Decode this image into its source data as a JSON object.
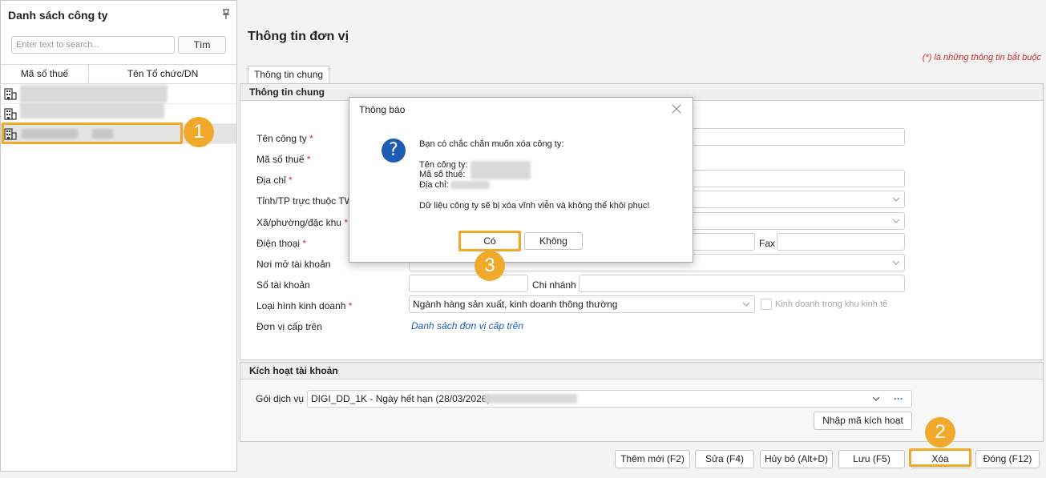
{
  "left_panel": {
    "title": "Danh sách công ty",
    "search_placeholder": "Enter text to search...",
    "search_button": "Tìm",
    "columns": [
      "Mã số thuế",
      "Tên Tổ chức/DN"
    ]
  },
  "form": {
    "title": "Thông tin đơn vị",
    "required_note": "(*) là những thông tin bắt buộc",
    "tab": "Thông tin chung",
    "section_general": "Thông tin chung",
    "fields": {
      "company_name": "Tên công ty",
      "tax_code": "Mã số thuế",
      "address": "Địa chỉ",
      "province": "Tỉnh/TP trực thuộc TW",
      "ward": "Xã/phường/đặc khu",
      "phone": "Điện thoại",
      "fax": "Fax",
      "bank": "Nơi mở tài khoản",
      "account_no": "Số tài khoản",
      "branch": "Chi nhánh",
      "business_type": "Loại hình kinh doanh",
      "parent_unit": "Đơn vị cấp trên"
    },
    "required_mark": "*",
    "business_type_value": "Ngành hàng sản xuất, kinh doanh thông thường",
    "industrial_zone_label": "Kinh doanh trong khu kinh tế",
    "parent_link": "Danh sách đơn vị cấp trên",
    "section_activation": "Kích hoạt tài khoản",
    "service_label": "Gói dịch vụ",
    "service_value": "DIGI_DD_1K - Ngày hết hạn (28/03/2026) -",
    "more_button": "···",
    "enter_code_button": "Nhập mã kích hoạt"
  },
  "toolbar": {
    "add": "Thêm mới (F2)",
    "edit": "Sửa (F4)",
    "cancel": "Hủy bỏ (Alt+D)",
    "save": "Lưu (F5)",
    "delete": "Xóa",
    "close": "Đóng (F12)"
  },
  "dialog": {
    "title": "Thông báo",
    "question": "Bạn có chắc chắn muốn xóa công ty:",
    "name_label": "Tên công ty:",
    "tax_label": "Mã số thuế:",
    "address_label": "Địa chỉ:",
    "warning": "Dữ liệu công ty sẽ bị xóa vĩnh viễn và không thể khôi phục!",
    "yes": "Có",
    "no": "Không"
  },
  "callouts": [
    "1",
    "2",
    "3"
  ],
  "colors": {
    "callout": "#f0a92a",
    "required": "#d12a2a",
    "link": "#1a5fb4",
    "question_icon": "#1d5bb4"
  }
}
